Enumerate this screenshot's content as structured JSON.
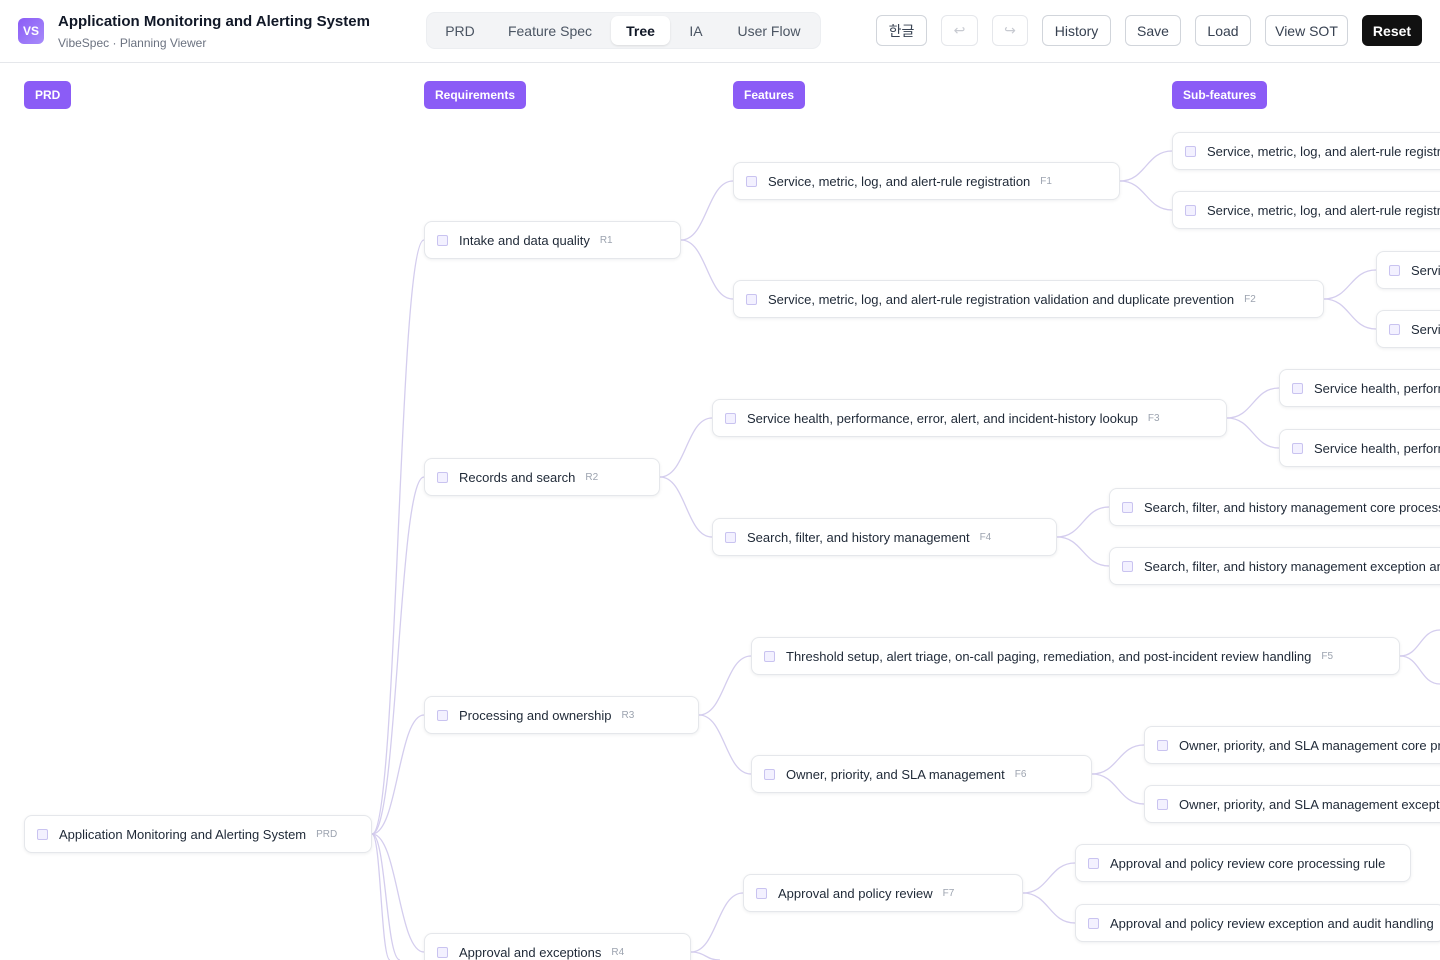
{
  "header": {
    "logo_text": "VS",
    "title": "Application Monitoring and Alerting System",
    "subtitle": "VibeSpec · Planning Viewer",
    "tabs": [
      {
        "label": "PRD",
        "active": false
      },
      {
        "label": "Feature Spec",
        "active": false
      },
      {
        "label": "Tree",
        "active": true
      },
      {
        "label": "IA",
        "active": false
      },
      {
        "label": "User Flow",
        "active": false
      }
    ],
    "buttons": {
      "language": "한글",
      "undo": "↩",
      "redo": "↪",
      "history": "History",
      "save": "Save",
      "load": "Load",
      "view_sot": "View SOT",
      "reset": "Reset"
    }
  },
  "columns": {
    "prd": "PRD",
    "requirements": "Requirements",
    "features": "Features",
    "subfeatures": "Sub-features"
  },
  "tree": {
    "root": {
      "label": "Application Monitoring and Alerting System",
      "code": "PRD"
    },
    "requirements": [
      {
        "label": "Intake and data quality",
        "code": "R1"
      },
      {
        "label": "Records and search",
        "code": "R2"
      },
      {
        "label": "Processing and ownership",
        "code": "R3"
      },
      {
        "label": "Approval and exceptions",
        "code": "R4"
      }
    ],
    "features": [
      {
        "label": "Service, metric, log, and alert-rule registration",
        "code": "F1"
      },
      {
        "label": "Service, metric, log, and alert-rule registration validation and duplicate prevention",
        "code": "F2"
      },
      {
        "label": "Service health, performance, error, alert, and incident-history lookup",
        "code": "F3"
      },
      {
        "label": "Search, filter, and history management",
        "code": "F4"
      },
      {
        "label": "Threshold setup, alert triage, on-call paging, remediation, and post-incident review handling",
        "code": "F5"
      },
      {
        "label": "Owner, priority, and SLA management",
        "code": "F6"
      },
      {
        "label": "Approval and policy review",
        "code": "F7"
      }
    ],
    "subfeatures": [
      {
        "label": "Service, metric, log, and alert-rule registra"
      },
      {
        "label": "Service, metric, log, and alert-rule registra"
      },
      {
        "label": "Servic"
      },
      {
        "label": "Servic"
      },
      {
        "label": "Service health, perform"
      },
      {
        "label": "Service health, perform"
      },
      {
        "label": "Search, filter, and history management core processi"
      },
      {
        "label": "Search, filter, and history management exception and"
      },
      {
        "label": "Owner, priority, and SLA management core pro"
      },
      {
        "label": "Owner, priority, and SLA management excepti"
      },
      {
        "label": "Approval and policy review core processing rule"
      },
      {
        "label": "Approval and policy review exception and audit handling"
      }
    ]
  }
}
